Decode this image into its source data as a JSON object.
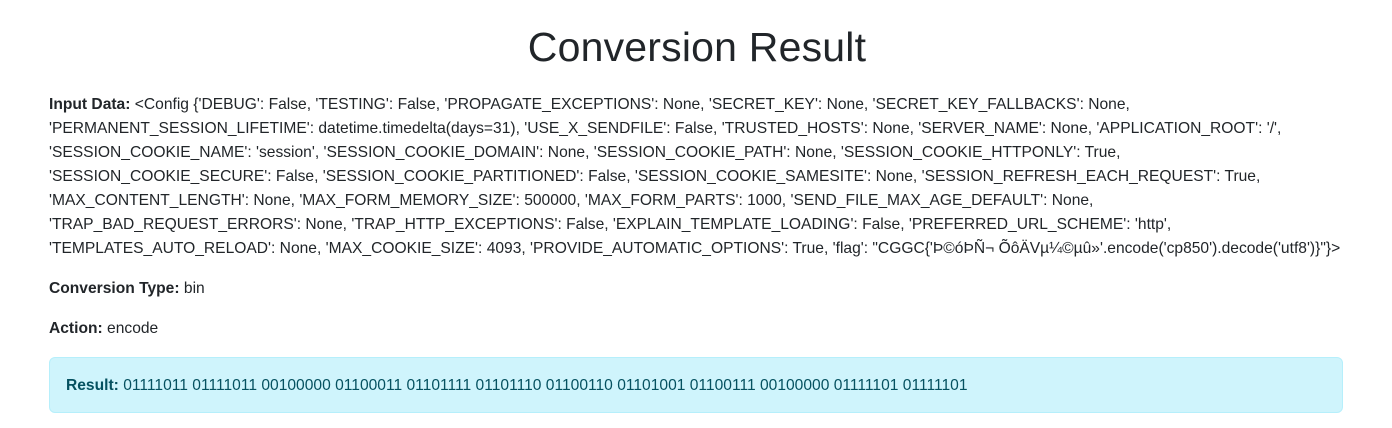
{
  "page": {
    "title": "Conversion Result"
  },
  "input": {
    "label": "Input Data:",
    "value": "<Config {'DEBUG': False, 'TESTING': False, 'PROPAGATE_EXCEPTIONS': None, 'SECRET_KEY': None, 'SECRET_KEY_FALLBACKS': None, 'PERMANENT_SESSION_LIFETIME': datetime.timedelta(days=31), 'USE_X_SENDFILE': False, 'TRUSTED_HOSTS': None, 'SERVER_NAME': None, 'APPLICATION_ROOT': '/', 'SESSION_COOKIE_NAME': 'session', 'SESSION_COOKIE_DOMAIN': None, 'SESSION_COOKIE_PATH': None, 'SESSION_COOKIE_HTTPONLY': True, 'SESSION_COOKIE_SECURE': False, 'SESSION_COOKIE_PARTITIONED': False, 'SESSION_COOKIE_SAMESITE': None, 'SESSION_REFRESH_EACH_REQUEST': True, 'MAX_CONTENT_LENGTH': None, 'MAX_FORM_MEMORY_SIZE': 500000, 'MAX_FORM_PARTS': 1000, 'SEND_FILE_MAX_AGE_DEFAULT': None, 'TRAP_BAD_REQUEST_ERRORS': None, 'TRAP_HTTP_EXCEPTIONS': False, 'EXPLAIN_TEMPLATE_LOADING': False, 'PREFERRED_URL_SCHEME': 'http', 'TEMPLATES_AUTO_RELOAD': None, 'MAX_COOKIE_SIZE': 4093, 'PROVIDE_AUTOMATIC_OPTIONS': True, 'flag': \"CGGC{'Þ©óÞÑ¬ ÕôÄVµ¼©µû»'.encode('cp850').decode('utf8')}\"}>"
  },
  "conversion_type": {
    "label": "Conversion Type:",
    "value": "bin"
  },
  "action": {
    "label": "Action:",
    "value": "encode"
  },
  "result": {
    "label": "Result:",
    "value": "01111011 01111011 00100000 01100011 01101111 01101110 01100110 01101001 01100111 00100000 01111101 01111101"
  },
  "colors": {
    "result_background": "#cff4fc",
    "result_border": "#b6effb",
    "result_text": "#055160"
  }
}
